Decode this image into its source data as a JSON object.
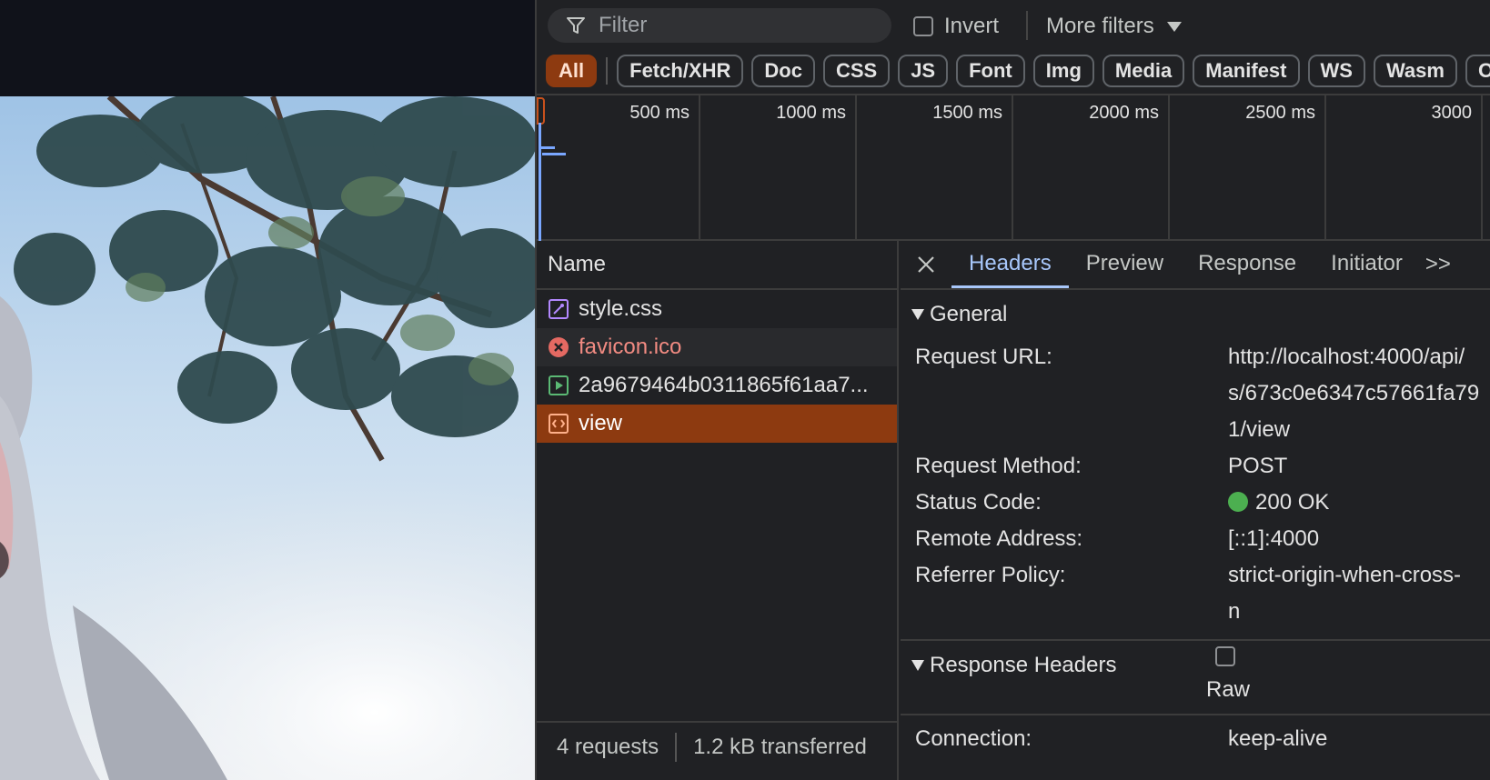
{
  "filter": {
    "placeholder": "Filter",
    "invert_label": "Invert",
    "more_filters_label": "More filters"
  },
  "type_chips": [
    "All",
    "Fetch/XHR",
    "Doc",
    "CSS",
    "JS",
    "Font",
    "Img",
    "Media",
    "Manifest",
    "WS",
    "Wasm",
    "Other"
  ],
  "timeline": {
    "ticks": [
      "500 ms",
      "1000 ms",
      "1500 ms",
      "2000 ms",
      "2500 ms",
      "3000"
    ]
  },
  "requests": {
    "column_header": "Name",
    "items": [
      {
        "name": "style.css",
        "icon": "stylesheet-icon",
        "state": "normal"
      },
      {
        "name": "favicon.ico",
        "icon": "error-icon",
        "state": "error"
      },
      {
        "name": "2a9679464b0311865f61aa7...",
        "icon": "media-play-icon",
        "state": "normal"
      },
      {
        "name": "view",
        "icon": "document-code-icon",
        "state": "selected"
      }
    ],
    "footer": {
      "count": "4 requests",
      "transferred": "1.2 kB transferred"
    }
  },
  "details": {
    "tabs": [
      "Headers",
      "Preview",
      "Response",
      "Initiator"
    ],
    "active_tab": "Headers",
    "more_tabs": ">>",
    "general": {
      "title": "General",
      "rows": [
        {
          "key": "Request URL:",
          "value": "http://localhost:4000/api/\ns/673c0e6347c57661fa79\n1/view"
        },
        {
          "key": "Request Method:",
          "value": "POST"
        },
        {
          "key": "Status Code:",
          "value": "200 OK"
        },
        {
          "key": "Remote Address:",
          "value": "[::1]:4000"
        },
        {
          "key": "Referrer Policy:",
          "value": "strict-origin-when-cross-\nn"
        }
      ]
    },
    "response_headers": {
      "title": "Response Headers",
      "raw_label": "Raw",
      "rows": [
        {
          "key": "Connection:",
          "value": "keep-alive"
        }
      ]
    }
  },
  "colors": {
    "accent": "#8d3a10",
    "tab_active": "#a8c7fa",
    "status_ok": "#4caf50",
    "error": "#f28b82"
  }
}
